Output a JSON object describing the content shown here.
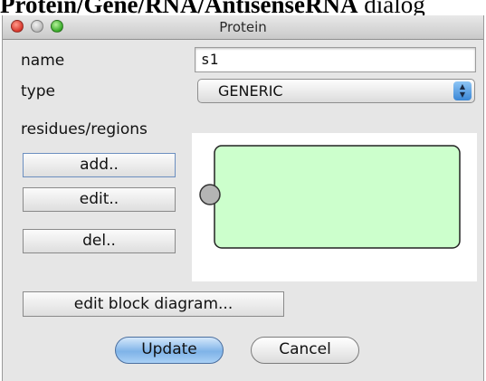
{
  "caption": {
    "bold_part": "Protein/Gene/RNA/AntisenseRNA",
    "normal_part": " dialog"
  },
  "window": {
    "title": "Protein"
  },
  "form": {
    "name_label": "name",
    "name_value": "s1",
    "type_label": "type",
    "type_value": "GENERIC",
    "residues_label": "residues/regions"
  },
  "buttons": {
    "add": "add..",
    "edit": "edit..",
    "del": "del..",
    "edit_block_diagram": "edit block diagram...",
    "update": "Update",
    "cancel": "Cancel"
  },
  "diagram": {
    "box_fill": "#ccffcc",
    "residue_fill": "#b4b4b4"
  },
  "colors": {
    "default_button": "#7fb3e8",
    "window_bg": "#e6e6e6"
  }
}
